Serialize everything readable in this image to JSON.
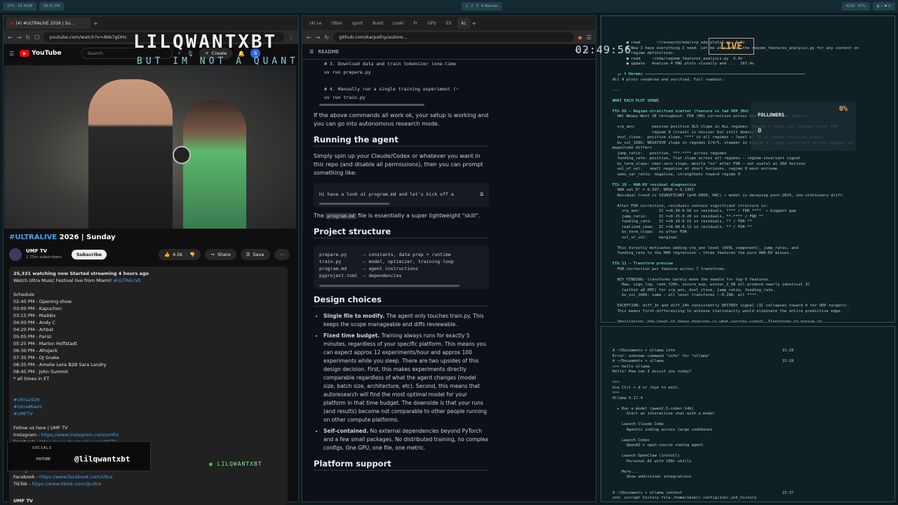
{
  "topbar": {
    "left_stats": [
      "27%",
      "15.4108"
    ],
    "left_time": "09:31 PM",
    "workspaces": [
      "1",
      "2",
      "3",
      "4 Hermes"
    ],
    "right": [
      "4100",
      "87%"
    ]
  },
  "yt_browser": {
    "tabs": [
      "(4) #ULTRALIVE 2026 | Su..."
    ],
    "url": "youtube.com/watch?v=AVe7gDHc",
    "search_placeholder": "Search",
    "create_label": "Create",
    "logo": "YouTube",
    "video_title_hash": "#ULTRALIVE",
    "video_title_rest": " 2026 | Sunday",
    "channel": "UMF TV",
    "subscribers": "1.75m subscribers",
    "subscribe": "Subscribe",
    "likes": "4.5k",
    "share": "Share",
    "save": "Save",
    "desc_meta": "25,331 watching now  Started streaming 4 hours ago",
    "desc_intro": "Watch Ultra Music Festival live from Miami! ",
    "desc_intro_tag": "#ULTRALIVE",
    "schedule_title": "Schedule",
    "schedule": [
      "02:45 PM - Opening show",
      "03:00 PM - Kapuchon",
      "03:15 PM - Maddix",
      "04:00 PM - Andy C",
      "04:20 PM - Artbat",
      "05:05 PM - Parisi",
      "05:25 PM - Marlon Hoffstadt",
      "06:30 PM - Afrojack",
      "07:35 PM - DJ Snake",
      "08:35 PM - Amelie Lens B2B Sara Landry",
      "08:45 PM - John Summit"
    ],
    "times_note": "* all times in ET",
    "tags": [
      "#Ultra2026",
      "#UltraMiami",
      "#UMFTV"
    ],
    "follow": "Follow us here | UMF TV",
    "links": [
      {
        "label": "Instagram - ",
        "url": "https://www.instagram.com/umftv"
      },
      {
        "label": "Facebook - ",
        "url": "https://www.facebook.com/UMFTV"
      }
    ],
    "links2": [
      {
        "label": "Instagram - ",
        "url": "https://www.instagram.com/ultra"
      },
      {
        "label": "Facebook - ",
        "url": "https://www.facebook.com/Ultra"
      },
      {
        "label": "TikTok - ",
        "url": "https://www.tiktok.com/@ultra"
      }
    ],
    "next_channel": "UMF TV"
  },
  "overlay": {
    "name": "LILQWANTXBT",
    "tagline": "BUT IM NOT A QUANT",
    "socials_title": "SOCIALS",
    "youtube": "YOUTUBE",
    "handle": "@lilqwantxbt",
    "live_handle": "LILQWANTXBT",
    "clock": "02:49:56",
    "live": "LIVE",
    "followers_label": "FOLLOWERS",
    "followers": "0",
    "pct": "0%"
  },
  "gh_browser": {
    "tabs": [
      "(4) Le",
      "Ollan",
      "spirit",
      "Build",
      "Looki",
      "Fr",
      "GPU",
      "ES",
      "kc"
    ],
    "url": "github.com/karpathy/autore...",
    "readme": "README",
    "code1": "# 3. Download data and train tokenizer (one-time\nuv run prepare.py\n\n# 4. Manually run a single training experiment (~\nuv run train.py",
    "p1": "If the above commands all work ok, your setup is working and you can go into autonomous research mode.",
    "h_running": "Running the agent",
    "p2": "Simply spin up your Claude/Codex or whatever you want in this repo (and disable all permissions), then you can prompt something like:",
    "code2": "Hi have a look at program.md and let's kick off a",
    "p3a": "The ",
    "p3code": "program.md",
    "p3b": " file is essentially a super lightweight \"skill\".",
    "h_structure": "Project structure",
    "code3": "prepare.py      — constants, data prep + runtime\ntrain.py        — model, optimizer, training loop\nprogram.md      — agent instructions\npyproject.toml  — dependencies",
    "h_design": "Design choices",
    "b1_title": "Single file to modify.",
    "b1_text": " The agent only touches train.py. This keeps the scope manageable and diffs reviewable.",
    "b2_title": "Fixed time budget.",
    "b2_text": " Training always runs for exactly 5 minutes, regardless of your specific platform. This means you can expect approx 12 experiments/hour and approx 100 experiments while you sleep. There are two upsides of this design decision. First, this makes experiments directly comparable regardless of what the agent changes (model size, batch size, architecture, etc). Second, this means that autoresearch will find the most optimal model for your platform in that time budget. The downside is that your runs (and results) become not comparable to other people running on other compute platforms.",
    "b3_title": "Self-contained.",
    "b3_text": " No external dependencies beyond PyTorch and a few small packages. No distributed training, no complex configs. One GPU, one file, one metric.",
    "h_platform": "Platform support"
  },
  "term_top": {
    "lines": [
      "      ● read       ~/research/eda/vrp_eda_plots2.py  0.9s",
      "      ● Now I have everything I need. Let me also check the regime_features_analysis.py for any context on",
      "        regime definitions.",
      "      ● read     ~/eda/regime_features_analysis.py  0.9s",
      "      ● update   Analyze 4 PNG plots visually and ...  167.4s",
      "",
      "  ╭─ ⚕ Hermes ─────────────────────────────────────────────────────────────────────",
      "All 4 plots rendered and verified. Full readout:",
      "",
      "---",
      "",
      "WHAT EACH PLOT SHOWS",
      "",
      "FIG 09 — Regime-stratified scatter (feature vs fwd VRP_30d)",
      "  HAC Newey-West SE throughout. FDR (BH) correction across the 4 regimes per feature.",
      "",
      "  vrp_ann:       massive positive OLS slope in ALL regimes. Regime 4 (high vol) steeper after FDR",
      "                 regime 0 (crash) is noisier but still dominates",
      "  dvol_close:  positive slope, **** in all regimes — level of IV is regime-invariant signal",
      "  bv_vol_168h: NEGATIVE slope in regimes 1/4/5, steeper in regime 0 — sign consistent across regimes but",
      "magnitude differs",
      "  jump_ratio:   positive, ***-**** across regimes",
      "  funding_rate: positive, flat slope across all regimes — regime-invariant signal",
      "  bv_term_slope: near-zero slope, mostly \"ns\" after FDR — not useful at 30d horizon",
      "  vol_of_vol:   small negative at short horizons, regime 0 most extreme",
      "  semi_var_ratio: negative, strengthens toward regime 0",
      "",
      "FIG 10 — HAR-RV residual diagnostics",
      "  HAR val R² = 0.507, RMSE = 0.1365",
      "  Residual trend is SIGNIFICANT (p=0.0000, HAC) → model is decaying post-2024, non-stationary drift.",
      "",
      "  After FDR correction, residuals contain significant structure in:",
      "    vrp_ann:        IC =+0.30-0.50 vs residuals, **** / FDR ****  ← biggest gap",
      "    jump_ratio:     IC =+0.15-0.20 vs residuals, **-**** / FDR **",
      "    funding_rate:   IC =+0.10-0.15 vs residuals, ** / FDR **",
      "    realized_skew:  IC =+0.08-0.12 vs residuals, ** / FDR **",
      "    bv_term_slope:  ns after FDR",
      "    vol_of_vol:     marginal",
      "",
      "  This directly motivates adding vrp_ann level (DVOL component), jump_ratio, and",
      "  funding_rate to the HAR regression — three features the pure HAR-RV misses.",
      "",
      "FIG 11 — Transform preview",
      "  FDR correction per feature across 7 transforms.",
      "",
      "  KEY FINDING: transforms barely move the needle for top-5 features.",
      "    Raw, sign_log, rank_720h, zscore_exp, winsor_2_98 all produce nearly identical IC",
      "    (within ±0.005) for vrp_ann, dvol_close, jump_ratio, funding_rate.",
      "    bv_vol_168h: same — all level transforms ~-0.288, all ****.",
      "",
      "  EXCEPTION: diff_1h and diff_24h consistently DESTROY signal (IC collapses toward 0 for VRP targets).",
      "  This means first-differencing to achieve stationarity would eliminate the entire predictive edge.",
      "",
      "  Implication: the level of these features is what carries signal. Transforms to pursue in",
      "  Phase 1 of autoresearch should focus on CLIPPING/WINSORIZING outliers and",
      "  NORMALIZATION (rank/z-score) for collinearity reduction, NOT differencing for stationarity."
    ]
  },
  "term_bottom": {
    "lines": [
      "A ~/Documents > ollama info                                              15:28",
      "Error: unknown command \"info\" for \"ollama\"",
      "A ~/Documents > ollama                                                   15:28",
      ">>> hello ollama",
      "Hello! How can I assist you today?",
      "",
      ">>>",
      "Use Ctrl + d or /bye to exit.",
      ">>>",
      "Ollama 0.17.4",
      "",
      "  ▸ Run a model (qwen2.5-coder:14b)",
      "      Start an interactive chat with a model",
      "",
      "    Launch Claude Code",
      "      Agentic coding across large codebases",
      "",
      "    Launch Codex",
      "      OpenAI's open-source coding agent",
      "",
      "    Launch OpenClaw (install)",
      "      Personal AI with 100+ skills",
      "",
      "    More...",
      "      Show additional integrations",
      "",
      "",
      "A ~/Documents > ollama context                                           15:37",
      "zsh: corrupt history file /home/skier/.config/zsh/.zsh_history",
      "A ~/Documents > ▯                                                          16:56"
    ]
  }
}
